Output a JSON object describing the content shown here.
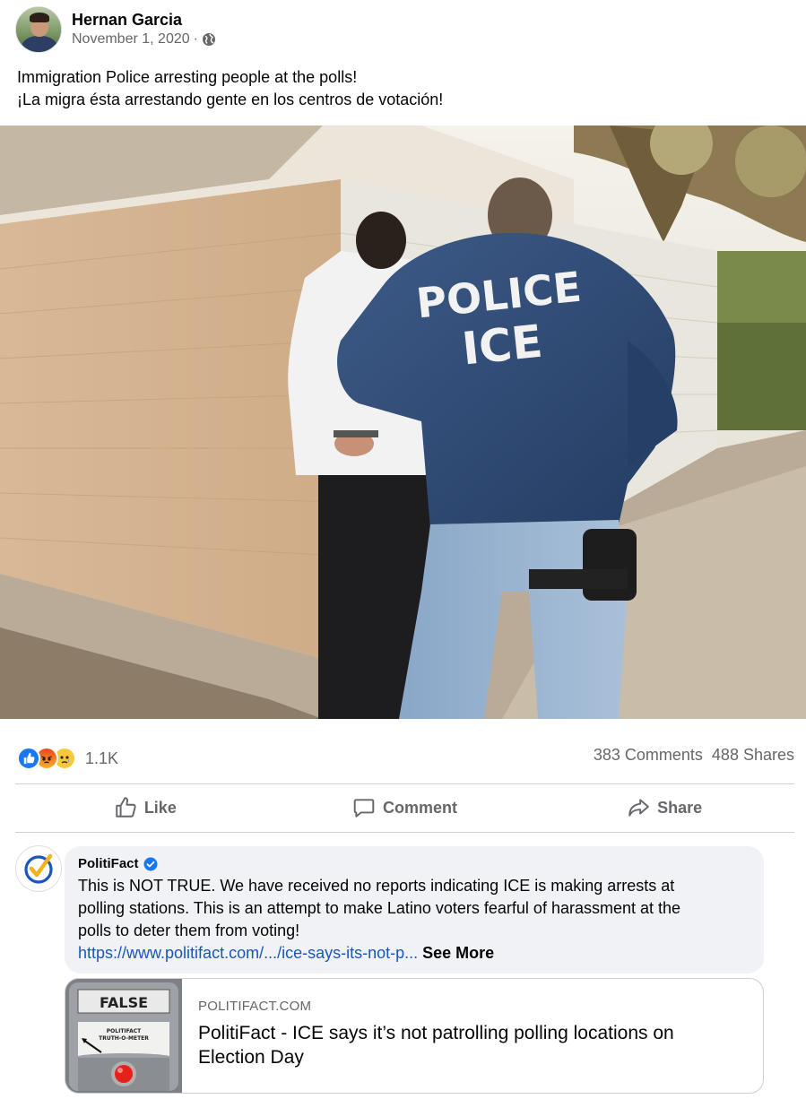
{
  "post": {
    "author": "Hernan Garcia",
    "date": "November 1, 2020",
    "separator": "·",
    "audience_icon": "globe-icon",
    "text_line_1": "Immigration Police arresting people at the polls!",
    "text_line_2": "¡La migra ésta arrestando gente en los centros de votación!",
    "photo": {
      "jacket_line_1": "POLICE",
      "jacket_line_2": "ICE"
    }
  },
  "stats": {
    "reactions": [
      "like",
      "angry",
      "sad"
    ],
    "reaction_count": "1.1K",
    "comments": "383 Comments",
    "shares": "488 Shares"
  },
  "actions": {
    "like": "Like",
    "comment": "Comment",
    "share": "Share"
  },
  "comment": {
    "author": "PolitiFact",
    "verified": true,
    "line_1": "This is NOT TRUE. We have received no reports indicating ICE is making arrests at",
    "line_2": "polling stations. This is an attempt to make Latino voters fearful of harassment at the",
    "line_3": "polls to deter them from voting!",
    "link": "https://www.politifact.com/.../ice-says-its-not-p...",
    "see_more": "See More"
  },
  "link_card": {
    "thumb_label": "FALSE",
    "thumb_sub_1": "POLITIFACT",
    "thumb_sub_2": "TRUTH-O-METER",
    "domain": "POLITIFACT.COM",
    "title_line_1": "PolitiFact - ICE says it’s not patrolling polling locations on",
    "title_line_2": "Election Day"
  },
  "colors": {
    "link": "#1a56bf",
    "secondary_text": "#65676b",
    "like_blue": "#1877f2",
    "jacket_blue": "#2f4d7a"
  }
}
